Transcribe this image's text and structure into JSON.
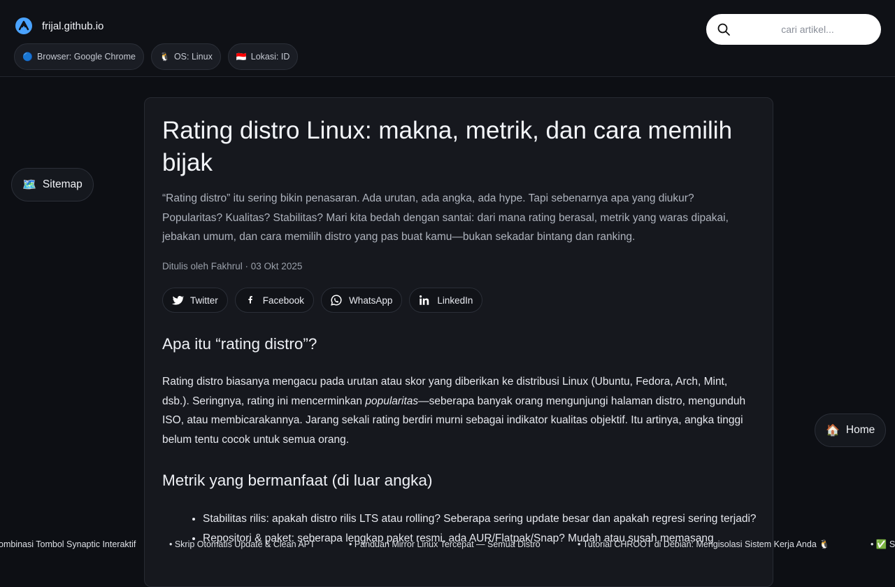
{
  "header": {
    "site_name": "frijal.github.io",
    "chips": [
      {
        "icon": "🔵",
        "label": "Browser: Google Chrome"
      },
      {
        "icon": "🐧",
        "label": "OS: Linux"
      },
      {
        "icon": "🇮🇩",
        "label": "Lokasi: ID"
      }
    ],
    "search": {
      "placeholder": "cari artikel..."
    }
  },
  "floating": {
    "sitemap": {
      "icon": "🗺️",
      "label": "Sitemap"
    },
    "home": {
      "icon": "🏠",
      "label": "Home"
    }
  },
  "article": {
    "title": "Rating distro Linux: makna, metrik, dan cara memilih bijak",
    "lead": "“Rating distro” itu sering bikin penasaran. Ada urutan, ada angka, ada hype. Tapi sebenarnya apa yang diukur? Popularitas? Kualitas? Stabilitas? Mari kita bedah dengan santai: dari mana rating berasal, metrik yang waras dipakai, jebakan umum, dan cara memilih distro yang pas buat kamu—bukan sekadar bintang dan ranking.",
    "meta": "Ditulis oleh Fakhrul · 03 Okt 2025",
    "share": {
      "twitter": "Twitter",
      "facebook": "Facebook",
      "whatsapp": "WhatsApp",
      "linkedin": "LinkedIn"
    },
    "section1": {
      "heading": "Apa itu “rating distro”?",
      "text_before": "Rating distro biasanya mengacu pada urutan atau skor yang diberikan ke distribusi Linux (Ubuntu, Fedora, Arch, Mint, dsb.). Seringnya, rating ini mencerminkan ",
      "emphasis": "popularitas",
      "text_after": "—seberapa banyak orang mengunjungi halaman distro, mengunduh ISO, atau membicarakannya. Jarang sekali rating berdiri murni sebagai indikator kualitas objektif. Itu artinya, angka tinggi belum tentu cocok untuk semua orang."
    },
    "section2": {
      "heading": "Metrik yang bermanfaat (di luar angka)",
      "items": [
        "Stabilitas rilis: apakah distro rilis LTS atau rolling? Seberapa sering update besar dan apakah regresi sering terjadi?",
        "Repositori & paket: seberapa lengkap paket resmi, ada AUR/Flatpak/Snap? Mudah atau susah memasang"
      ]
    }
  },
  "ticker": [
    "ombinasi Tombol Synaptic Interaktif",
    "• Skrip Otomatis Update & Clean APT",
    "• Panduan Mirror Linux Tercepat — Semua Distro",
    "• Tutorial CHROOT di Debian: Mengisolasi Sistem Kerja Anda 🐧",
    "• ✅ S"
  ]
}
